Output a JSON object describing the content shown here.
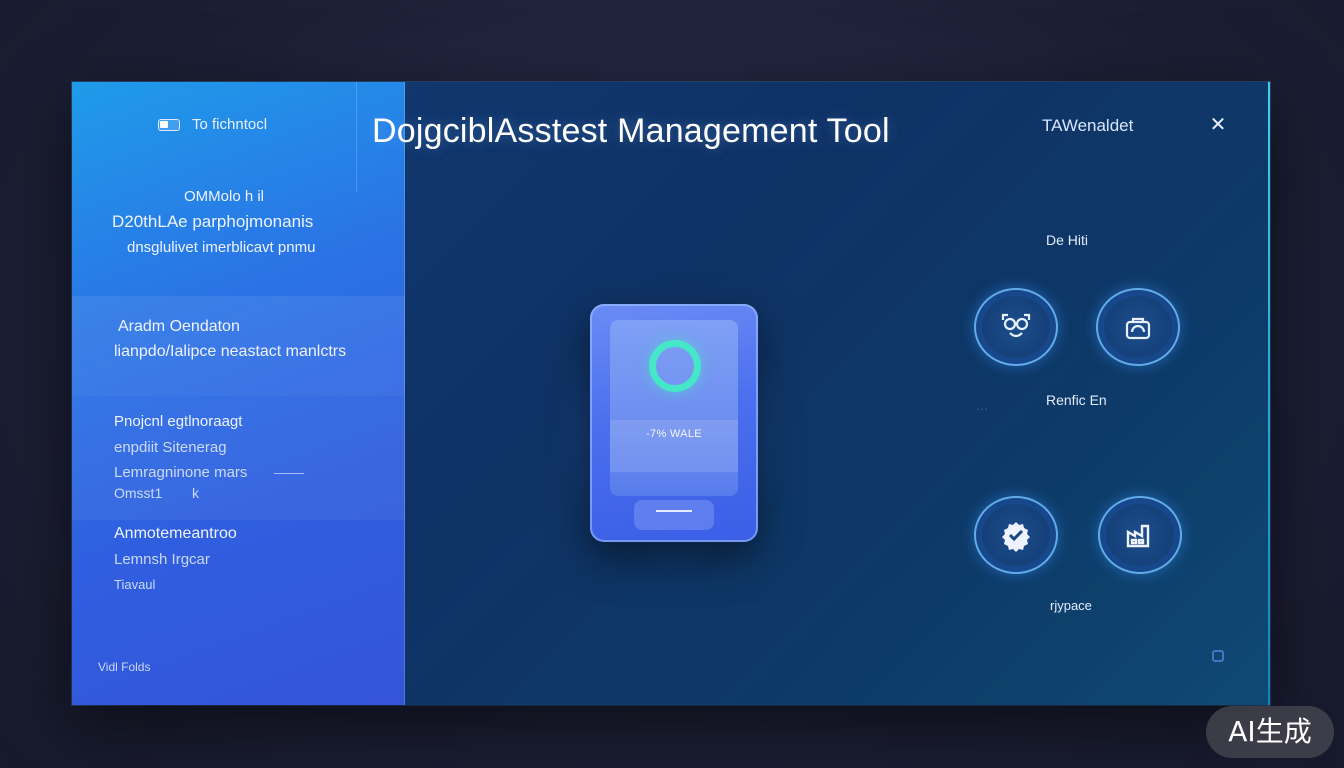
{
  "header": {
    "title": "DojgciblAsstest Management Tool",
    "left_label": "To fichntocl",
    "right_label": "TAWenaldet"
  },
  "sidebar": {
    "block1": {
      "line1": "OMMolo h il",
      "line2": "D20thLAe parphojmonanis",
      "line3": "dnsglulivet imerblicavt pnmu"
    },
    "block2": {
      "line1": "Aradm Oendaton",
      "line2": "lianpdo/Ialipce neastact manlctrs"
    },
    "block3": {
      "line1": "Pnojcnl egtlnoraagt",
      "line2": "enpdiit Sitenerag",
      "line3": "Lemragninone mars",
      "line4": "Omsst1",
      "line4_suffix": "k"
    },
    "block4": {
      "line1": "Anmotemeantroo",
      "line2": "Lemnsh Irgcar",
      "line3": "Tiavaul"
    },
    "footer": "Vidl Folds"
  },
  "device": {
    "label": "-7% WALE"
  },
  "right_panel": {
    "heading_top": "De Hiti",
    "heading_mid": "Renfic En",
    "heading_bottom": "rjypace",
    "buttons": [
      {
        "icon": "face-scan-icon"
      },
      {
        "icon": "camera-lock-icon"
      },
      {
        "icon": "gear-check-icon"
      },
      {
        "icon": "factory-icon"
      }
    ]
  },
  "watermark": "AI生成",
  "colors": {
    "sidebar": "#2f6fe6",
    "main": "#103468",
    "accent_ring": "#46e6c8",
    "text": "#ffffff"
  }
}
